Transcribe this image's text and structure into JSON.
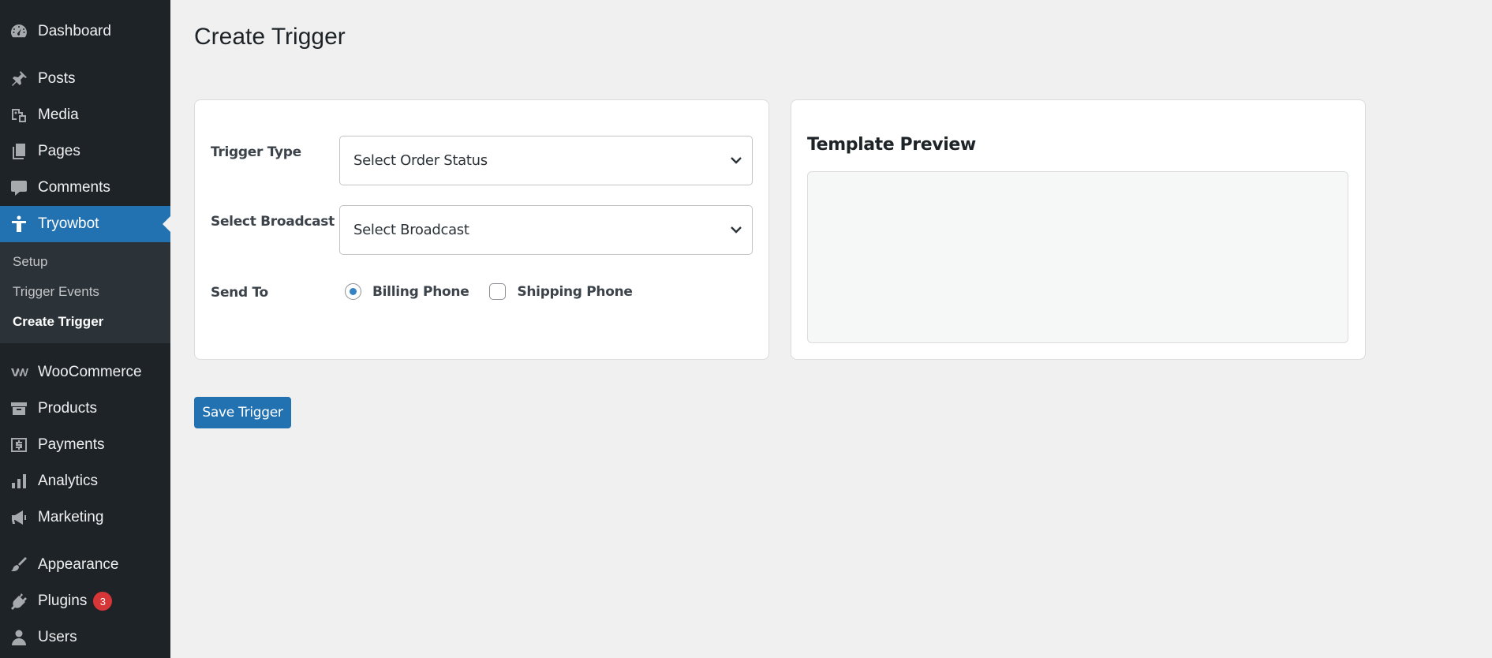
{
  "sidebar": {
    "items": [
      {
        "label": "Dashboard",
        "icon": "dashboard-icon"
      },
      {
        "label": "Posts",
        "icon": "pin-icon"
      },
      {
        "label": "Media",
        "icon": "media-icon"
      },
      {
        "label": "Pages",
        "icon": "pages-icon"
      },
      {
        "label": "Comments",
        "icon": "comment-icon"
      },
      {
        "label": "Tryowbot",
        "icon": "person-icon"
      },
      {
        "label": "WooCommerce",
        "icon": "woocommerce-icon"
      },
      {
        "label": "Products",
        "icon": "archive-icon"
      },
      {
        "label": "Payments",
        "icon": "dollar-icon"
      },
      {
        "label": "Analytics",
        "icon": "bar-chart-icon"
      },
      {
        "label": "Marketing",
        "icon": "megaphone-icon"
      },
      {
        "label": "Appearance",
        "icon": "brush-icon"
      },
      {
        "label": "Plugins",
        "icon": "plug-icon",
        "badge": "3"
      },
      {
        "label": "Users",
        "icon": "user-icon"
      }
    ],
    "submenu": [
      "Setup",
      "Trigger Events",
      "Create Trigger"
    ],
    "active_color": "#2271b1"
  },
  "page": {
    "title": "Create Trigger"
  },
  "form": {
    "trigger_type": {
      "label": "Trigger Type",
      "value": "Select Order Status"
    },
    "broadcast": {
      "label": "Select Broadcast",
      "value": "Select Broadcast"
    },
    "send_to": {
      "label": "Send To",
      "options": [
        {
          "label": "Billing Phone",
          "checked": true
        },
        {
          "label": "Shipping Phone",
          "checked": false
        }
      ]
    }
  },
  "preview": {
    "title": "Template Preview"
  },
  "actions": {
    "save_label": "Save Trigger"
  }
}
